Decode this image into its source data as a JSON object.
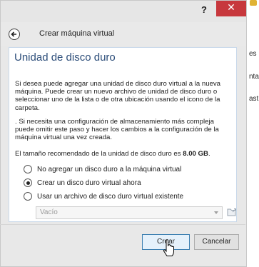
{
  "window": {
    "help_label": "?",
    "close_label": "✕",
    "nav_title": "Crear máquina virtual"
  },
  "panel": {
    "heading": "Unidad de disco duro",
    "paragraph1": "Si desea puede agregar una unidad de disco duro virtual a la nueva máquina. Puede crear un nuevo archivo de unidad de disco duro o seleccionar uno de la lista o de otra ubicación usando el icono de la carpeta.",
    "paragraph2": ". Si necesita una configuración de almacenamiento más compleja puede omitir este paso y hacer los cambios a la configuración de la máquina virtual una vez creada.",
    "recommended_prefix": "El tamaño recomendado de la unidad de disco duro es ",
    "recommended_size": "8.00 GB",
    "recommended_suffix": "."
  },
  "options": [
    {
      "label": "No agregar un disco duro a la máquina virtual",
      "selected": false
    },
    {
      "label": "Crear un disco duro virtual ahora",
      "selected": true
    },
    {
      "label": "Usar un archivo de disco duro virtual existente",
      "selected": false
    }
  ],
  "existing_file_combo": {
    "value": "Vacío",
    "enabled": false
  },
  "buttons": {
    "create": "Crear",
    "cancel": "Cancelar"
  },
  "background_peek": [
    "es",
    "nta",
    "ast"
  ]
}
